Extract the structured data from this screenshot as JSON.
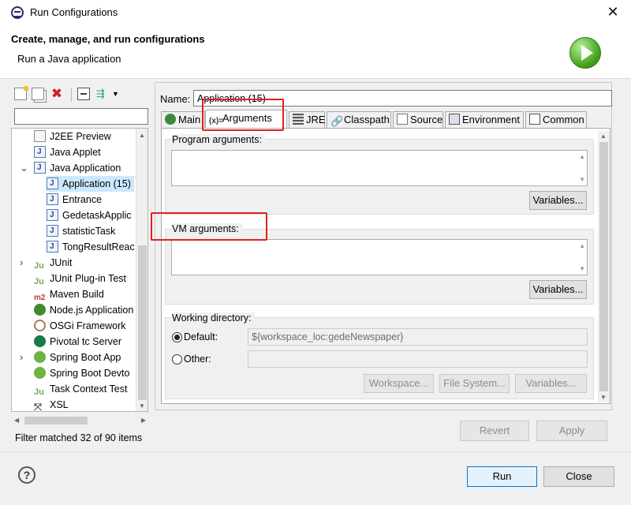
{
  "window": {
    "title": "Run Configurations",
    "close_glyph": "✕"
  },
  "header": {
    "title": "Create, manage, and run configurations",
    "subtitle": "Run a Java application"
  },
  "filter": {
    "value": ""
  },
  "tree": {
    "items": [
      {
        "label": "J2EE Preview",
        "icon": "ico-j2ee",
        "indent": 1,
        "selected": false
      },
      {
        "label": "Java Applet",
        "icon": "ico-j",
        "indent": 1,
        "selected": false
      },
      {
        "label": "Java Application",
        "icon": "ico-j",
        "indent": 1,
        "selected": false,
        "expanded": true
      },
      {
        "label": "Application (15)",
        "icon": "ico-j",
        "indent": 2,
        "selected": true
      },
      {
        "label": "Entrance",
        "icon": "ico-j",
        "indent": 2,
        "selected": false
      },
      {
        "label": "GedetaskApplic",
        "icon": "ico-j",
        "indent": 2,
        "selected": false
      },
      {
        "label": "statisticTask",
        "icon": "ico-j",
        "indent": 2,
        "selected": false
      },
      {
        "label": "TongResultReac",
        "icon": "ico-j",
        "indent": 2,
        "selected": false
      },
      {
        "label": "JUnit",
        "icon": "ico-ju",
        "indent": 1,
        "selected": false,
        "collapsed": true
      },
      {
        "label": "JUnit Plug-in Test",
        "icon": "ico-ju",
        "indent": 1,
        "selected": false
      },
      {
        "label": "Maven Build",
        "icon": "ico-m2",
        "indent": 1,
        "selected": false
      },
      {
        "label": "Node.js Application",
        "icon": "ico-node",
        "indent": 1,
        "selected": false
      },
      {
        "label": "OSGi Framework",
        "icon": "ico-osgi",
        "indent": 1,
        "selected": false
      },
      {
        "label": "Pivotal tc Server",
        "icon": "ico-pivotal",
        "indent": 1,
        "selected": false
      },
      {
        "label": "Spring Boot App",
        "icon": "ico-spring",
        "indent": 1,
        "selected": false,
        "collapsed": true
      },
      {
        "label": "Spring Boot Devto",
        "icon": "ico-spring",
        "indent": 1,
        "selected": false
      },
      {
        "label": "Task Context Test",
        "icon": "ico-ju",
        "indent": 1,
        "selected": false
      },
      {
        "label": "XSL",
        "icon": "ico-xsl",
        "indent": 1,
        "selected": false
      }
    ],
    "status": "Filter matched 32 of 90 items"
  },
  "config": {
    "name_label": "Name:",
    "name_value": "Application (15)",
    "tabs": [
      {
        "label": "Main",
        "icon": "ico-main",
        "glyph": ""
      },
      {
        "label": "Arguments",
        "icon": "ico-args",
        "glyph": "(x)=",
        "active": true
      },
      {
        "label": "JRE",
        "icon": "ico-jre",
        "glyph": ""
      },
      {
        "label": "Classpath",
        "icon": "ico-cp",
        "glyph": "🔗"
      },
      {
        "label": "Source",
        "icon": "ico-src",
        "glyph": ""
      },
      {
        "label": "Environment",
        "icon": "ico-env",
        "glyph": ""
      },
      {
        "label": "Common",
        "icon": "ico-common",
        "glyph": ""
      }
    ],
    "program_args_label": "Program arguments:",
    "program_args_value": "",
    "vm_args_label": "VM arguments:",
    "vm_args_value": "",
    "variables_label": "Variables...",
    "working_dir_label": "Working directory:",
    "default_label": "Default:",
    "default_value": "${workspace_loc:gedeNewspaper}",
    "other_label": "Other:",
    "other_value": "",
    "workspace_label": "Workspace...",
    "filesystem_label": "File System...",
    "revert_label": "Revert",
    "apply_label": "Apply"
  },
  "footer": {
    "run_label": "Run",
    "close_label": "Close",
    "help_glyph": "?"
  }
}
